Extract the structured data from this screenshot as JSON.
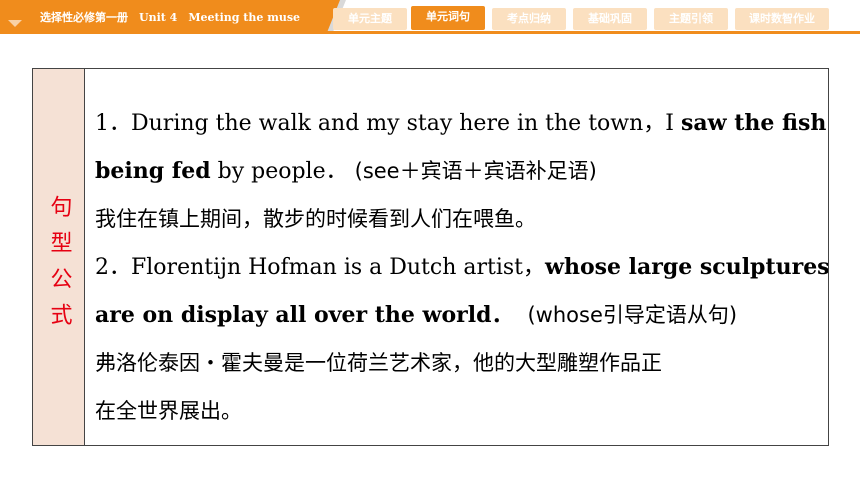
{
  "header": {
    "title": "选择性必修第一册　Unit 4　Meeting the muse",
    "tabs": [
      {
        "label": "单元主题",
        "active": false
      },
      {
        "label": "单元词句",
        "active": true
      },
      {
        "label": "考点归纳",
        "active": false
      },
      {
        "label": "基础巩固",
        "active": false
      },
      {
        "label": "主题引领",
        "active": false
      },
      {
        "label": "课时数智作业",
        "active": false
      }
    ],
    "accent_color": "#f08c1c",
    "tab_inactive_color": "#fbe0c0"
  },
  "side_label": "句型公式",
  "side_label_color": "#e60012",
  "side_background": "#f5e1d5",
  "content": {
    "s1": {
      "l1_num": "1．",
      "l1_text": "During the walk and my stay here in the town，I ",
      "l1_bold": "saw the fish",
      "l2_bold": "being fed",
      "l2_text": " by people．",
      "l2_note": "(see＋宾语＋宾语补足语)",
      "cn": "我住在镇上期间，散步的时候看到人们在喂鱼。"
    },
    "s2": {
      "l1_num": "2．",
      "l1_text": "Florentijn Hofman is a Dutch artist，",
      "l1_bold": "whose large sculptures",
      "l2_bold": "are on display all over the world．",
      "l2_note": "(whose引导定语从句)",
      "cn1": "弗洛伦泰因・霍夫曼是一位荷兰艺术家，他的大型雕塑作品正",
      "cn2": "在全世界展出。"
    }
  }
}
